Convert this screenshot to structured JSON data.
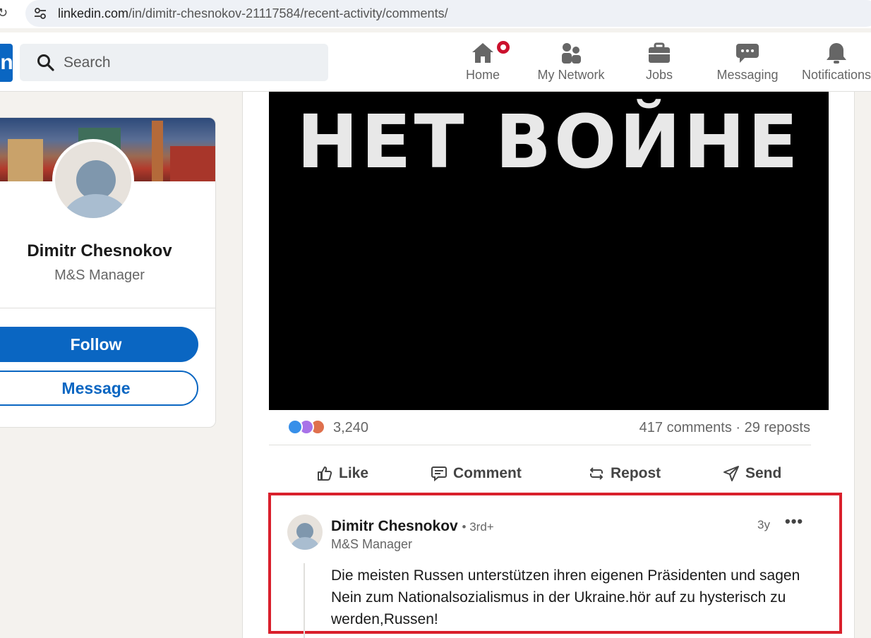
{
  "browser": {
    "url_domain": "linkedin.com",
    "url_path": "/in/dimitr-chesnokov-21117584/recent-activity/comments/"
  },
  "header": {
    "search_placeholder": "Search",
    "nav": [
      {
        "label": "Home",
        "icon": "home-icon"
      },
      {
        "label": "My Network",
        "icon": "network-icon"
      },
      {
        "label": "Jobs",
        "icon": "briefcase-icon"
      },
      {
        "label": "Messaging",
        "icon": "chat-icon"
      },
      {
        "label": "Notifications",
        "icon": "bell-icon"
      }
    ]
  },
  "profile": {
    "name": "Dimitr Chesnokov",
    "title": "M&S Manager",
    "follow_label": "Follow",
    "message_label": "Message"
  },
  "post": {
    "image_text": "НЕТ ВОЙНЕ",
    "reaction_count": "3,240",
    "comments_reposts": "417 comments · 29 reposts",
    "actions": {
      "like": "Like",
      "comment": "Comment",
      "repost": "Repost",
      "send": "Send"
    }
  },
  "comment": {
    "author": "Dimitr Chesnokov",
    "degree": "• 3rd+",
    "author_title": "M&S Manager",
    "time": "3y",
    "more": "•••",
    "text": "Die meisten Russen unterstützen ihren eigenen Präsidenten und sagen Nein zum Nationalsozialismus in der Ukraine.hör auf zu hysterisch zu werden,Russen!"
  },
  "colors": {
    "brand": "#0a66c2",
    "highlight": "#d9202c",
    "notification": "#cb112d"
  }
}
